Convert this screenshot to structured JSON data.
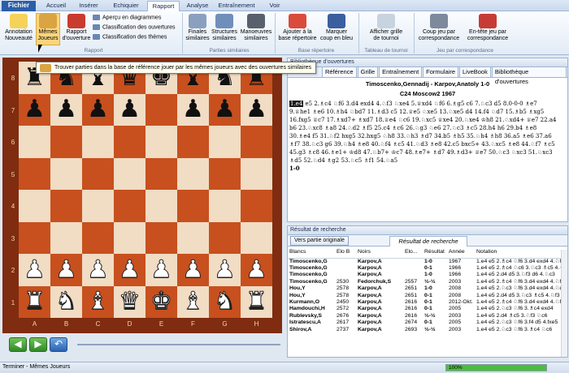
{
  "tabs": [
    "Fichier",
    "Accueil",
    "Insérer",
    "Echiquier",
    "Rapport",
    "Analyse",
    "Entraînement",
    "Voir"
  ],
  "ribbon": {
    "buttons": [
      {
        "label": "Annotation\nNouveauté",
        "name": "annotation-nouveaute-button"
      },
      {
        "label": "Mêmes\nJoueurs",
        "name": "memes-joueurs-button"
      },
      {
        "label": "Rapport\nd'ouverture",
        "name": "rapport-ouverture-button"
      },
      {
        "label": "Finales\nsimilaires",
        "name": "finales-similaires-button"
      },
      {
        "label": "Structures\nsimilaires",
        "name": "structures-similaires-button"
      },
      {
        "label": "Manoeuvres\nsimilaires",
        "name": "manoeuvres-similaires-button"
      },
      {
        "label": "Ajouter à la\nbase répertoire",
        "name": "ajouter-repertoire-button"
      },
      {
        "label": "Marquer\ncoup en bleu",
        "name": "marquer-bleu-button"
      },
      {
        "label": "Afficher grille\nde tournoi",
        "name": "grille-tournoi-button"
      },
      {
        "label": "Coup jeu par\ncorrespondance",
        "name": "coup-correspondance-button"
      },
      {
        "label": "En-tête jeu par\ncorrespondance",
        "name": "entete-correspondance-button"
      }
    ],
    "small": [
      "Aperçu en diagrammes",
      "Classification des ouvertures",
      "Classification des thèmes"
    ],
    "groups": [
      "Rapport",
      "Parties similaires",
      "Base répertoire",
      "Tableau de tournoi",
      "Jeu par correspondance"
    ]
  },
  "tooltip": "Trouver parties dans la base de référence jouer par les mêmes joueurs avec des ouvertures similaires",
  "board": {
    "ranks": [
      "8",
      "7",
      "6",
      "5",
      "4",
      "3",
      "2",
      "1"
    ],
    "files": [
      "A",
      "B",
      "C",
      "D",
      "E",
      "F",
      "G",
      "H"
    ],
    "rows": [
      [
        "bR",
        "bN",
        "bB",
        "bQ",
        "bK",
        "bB",
        "bN",
        "bR"
      ],
      [
        "bP",
        "bP",
        "bP",
        "bP",
        "",
        "bP",
        "bP",
        "bP"
      ],
      [
        "",
        "",
        "",
        "",
        "",
        "",
        "",
        ""
      ],
      [
        "",
        "",
        "",
        "",
        "",
        "",
        "",
        ""
      ],
      [
        "",
        "",
        "",
        "",
        "",
        "",
        "",
        ""
      ],
      [
        "",
        "",
        "",
        "",
        "",
        "",
        "",
        ""
      ],
      [
        "wP",
        "wP",
        "wP",
        "wP",
        "wP",
        "wP",
        "wP",
        "wP"
      ],
      [
        "wR",
        "wN",
        "wB",
        "wQ",
        "wK",
        "wB",
        "wN",
        "wR"
      ]
    ]
  },
  "notation_panel": {
    "header": "Bibliothèque d'ouvertures",
    "tabs": [
      "Référence",
      "Grille",
      "Entraînement",
      "Formulaire",
      "LiveBook",
      "Bibliothèque d'ouvertures"
    ],
    "game_title": "Timoscenko,Gennadij - Karpov,Anatoly  1-0",
    "game_sub": "C24 Moscow2 1967",
    "first_move": "1.e4",
    "moves": "e5 2.♗c4 ♘f6 3.d4 exd4 4.♘f3 ♘xe4 5.♕xd4 ♘f6 6.♗g5 c6 7.♘c3 d5 8.0-0-0 ♗e7 9.♕he1 ♗e6 10.♗h4 ♘bd7 11.♗d3 c5 12.♕e5 ♘xe5 13.♘xe5 d4 14.f4 ♘d7 15.♗b5 ♗xg5 16.fxg5 ♕c7 17.♗xd7+ ♗xd7 18.♕e4 ♘c6 19.♘xc5 ♕xe4 20.♘xe4 ♔h8 21.♘xd4+ ♕e7 22.a4 b6 23.♘xc8 ♗a8 24.♘d2 ♗f5 25.c4 ♗c6 26.♘g3 ♘e6 27.♘c3 ♗c5 28.h4 h6 29.b4 ♗e8 30.♗e4 f5 31.♘f2 hxg5 32.hxg5 ♘h8 33.♘h3 ♗d7 34.b5 ♗h5 35.♘h4 ♗h8 36.a5 ♗e6 37.a6 ♗f7 38.♘c3 g6 39.♘h4 ♗e8 40.♘f4 ♗c5 41.♘d3 ♗e8 42.c5 bxc5+ 43.♘xc5 ♗e8 44.♘f7 ♗c5 45.g3 ♗c8 46.♗e1+ ♔d8 47.♘b7+ ♔c7 48.♗e7+ ♗d7 49.♗d3+ ♕e7 50.♘c3 ♘xc3 51.♘xc3 ♗d5 52.♘d4 ♗g2 53.♘c5 ♗f1 54.♘a5",
    "result": "1-0"
  },
  "results_panel": {
    "header": "Résultat de recherche",
    "button": "Vers partie originale",
    "tab": "Résultat de recherche",
    "columns": [
      "Blancs",
      "Elo B",
      "Noirs",
      "Elo...",
      "Résultat",
      "Année",
      "Notation"
    ],
    "rows": [
      [
        "Timoscenko,G",
        "",
        "Karpov,A",
        "",
        "1-0",
        "1967",
        "1.e4 e5 2.♗c4 ♘f6 3.d4 exd4 4.♘f3"
      ],
      [
        "Timoscenko,G",
        "",
        "Karpov,A",
        "",
        "0-1",
        "1966",
        "1.e4 e5 2.♗c4 ♘c6 3.♘c3 ♗c5 4.♘f3"
      ],
      [
        "Timoscenko,G",
        "",
        "Karpov,A",
        "",
        "1-0",
        "1966",
        "1.e4 e5 2.d4 d5 3.♘f3 d6 4.♘c3"
      ],
      [
        "Timoscenko,G",
        "2530",
        "Fedorchuk,S",
        "2557",
        "½-½",
        "2003",
        "1.e4 e5 2.♗c4 ♘f6 3.d4 exd4 4.♘f3"
      ],
      [
        "Hou,Y",
        "2578",
        "Karpov,A",
        "2651",
        "1-0",
        "2008",
        "1.e4 e5 2.♘c3 ♘f6 3.d4 exd4 4.♘d3"
      ],
      [
        "Hou,Y",
        "2578",
        "Karpov,A",
        "2651",
        "0-1",
        "2008",
        "1.e4 e5 2.d4 d5 3.♘c3 ♗c5 4.♘f3"
      ],
      [
        "Kurmann,O",
        "2450",
        "Karpov,A",
        "2616",
        "0-1",
        "2012-Okt.",
        "1.e4 e5 2.♗c4 ♘f6 3.d4 exd4 4.♘f3"
      ],
      [
        "Hamdouchi,H",
        "2572",
        "Karpov,A",
        "2616",
        "0-1",
        "2005",
        "1.e4 e5 2.♘c3 ♘f6 3.♗c4 exd4"
      ],
      [
        "Rublevsky,S",
        "2676",
        "Karpov,A",
        "2616",
        "½-½",
        "2003",
        "1.e4 e5 2.d4 ♗c5 3.♘f3 ♘c6"
      ],
      [
        "Istratescu,A",
        "2617",
        "Karpov,A",
        "2674",
        "0-1",
        "2005",
        "1.e4 e5 2.♘c3 ♘f6 3.f4 d5 4.fxe5"
      ],
      [
        "Shirov,A",
        "2737",
        "Karpov,A",
        "2693",
        "½-½",
        "2003",
        "1.e4 e5 2.♘c3 ♘f6 3.♗c4 ♘c6"
      ]
    ]
  },
  "status": {
    "text": "Terminer - Mêmes Joueurs",
    "progress_label": "100%",
    "progress": 1.0
  },
  "colors": {
    "accent": "#2b5ea8",
    "progress": "#4cbe3c",
    "board_dark": "#c7501e",
    "board_light": "#f1dcc4"
  }
}
